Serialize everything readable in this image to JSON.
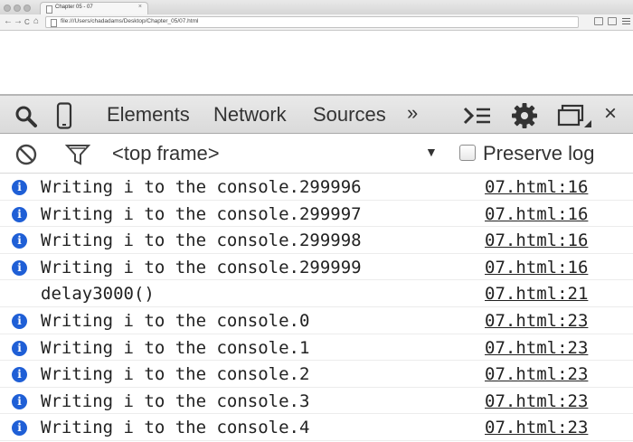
{
  "browser": {
    "tab_title": "Chapter 05 - 07",
    "tab_close": "×",
    "url": "file:///Users/chadadams/Desktop/Chapter_05/07.html",
    "nav_back": "←",
    "nav_forward": "→",
    "nav_reload": "C",
    "nav_home": "⌂"
  },
  "devtools": {
    "tabs": [
      "Elements",
      "Network",
      "Sources"
    ],
    "more": "»",
    "close": "×"
  },
  "console_toolbar": {
    "frame": "<top frame>",
    "frame_arrow": "▼",
    "preserve_log": "Preserve log"
  },
  "console": {
    "entries": [
      {
        "level": "info",
        "message": "Writing i to the console.299996",
        "source": "07.html:16"
      },
      {
        "level": "info",
        "message": "Writing i to the console.299997",
        "source": "07.html:16"
      },
      {
        "level": "info",
        "message": "Writing i to the console.299998",
        "source": "07.html:16"
      },
      {
        "level": "info",
        "message": "Writing i to the console.299999",
        "source": "07.html:16"
      },
      {
        "level": "log",
        "message": "delay3000()",
        "source": "07.html:21"
      },
      {
        "level": "info",
        "message": "Writing i to the console.0",
        "source": "07.html:23"
      },
      {
        "level": "info",
        "message": "Writing i to the console.1",
        "source": "07.html:23"
      },
      {
        "level": "info",
        "message": "Writing i to the console.2",
        "source": "07.html:23"
      },
      {
        "level": "info",
        "message": "Writing i to the console.3",
        "source": "07.html:23"
      },
      {
        "level": "info",
        "message": "Writing i to the console.4",
        "source": "07.html:23"
      }
    ]
  },
  "colors": {
    "info_icon": "#1f5fd6",
    "text": "#222222"
  }
}
